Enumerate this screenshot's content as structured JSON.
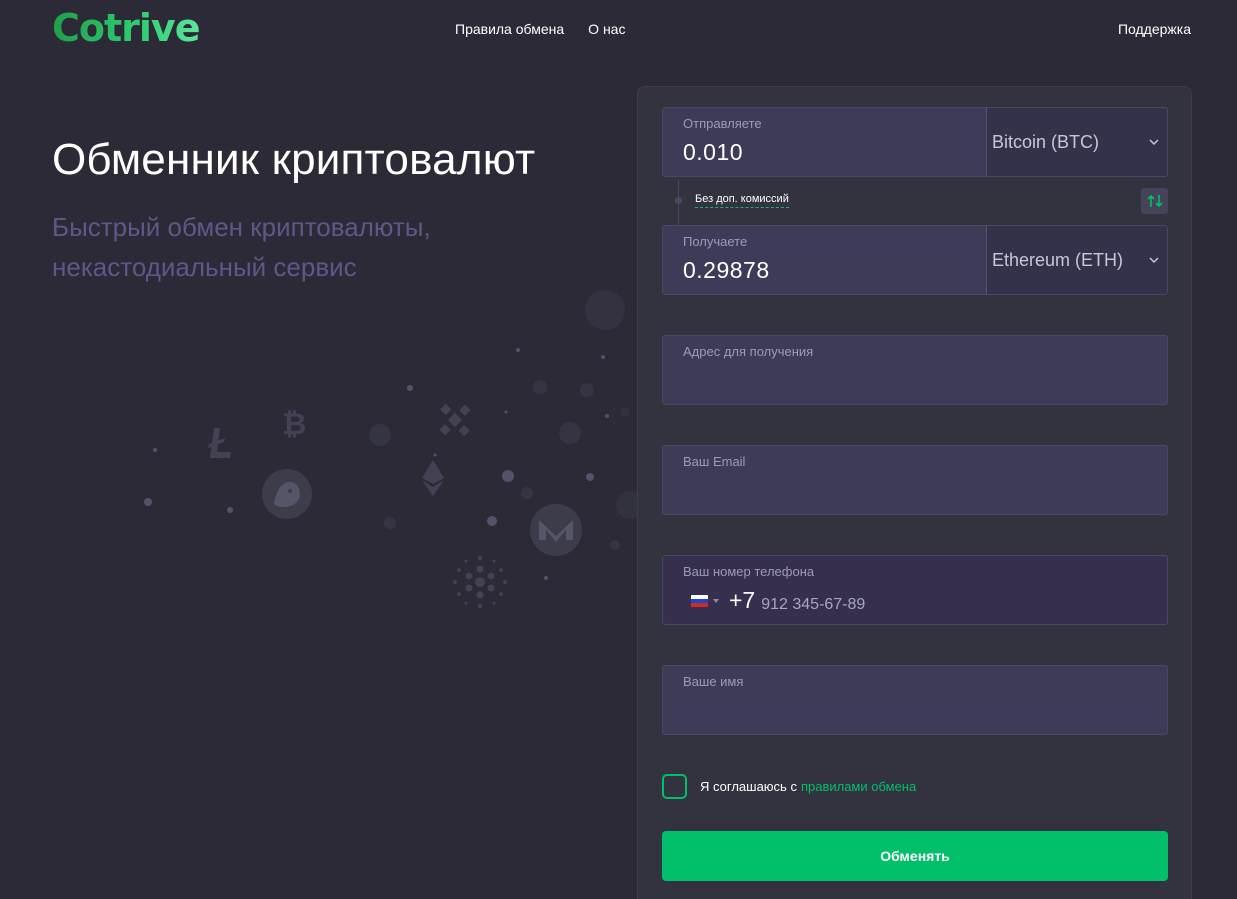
{
  "header": {
    "logo": "Cotrive",
    "nav": [
      "Правила обмена",
      "О нас"
    ],
    "support": "Поддержка"
  },
  "hero": {
    "title": "Обменник криптовалют",
    "subtitle": "Быстрый обмен криптовалюты, некастодиальный сервис"
  },
  "exchange": {
    "send": {
      "label": "Отправляете",
      "amount": "0.010",
      "currency": "Bitcoin (BTC)"
    },
    "no_fee": "Без доп. комиссий",
    "receive": {
      "label": "Получаете",
      "amount": "0.29878",
      "currency": "Ethereum (ETH)"
    }
  },
  "form": {
    "address_label": "Адрес для получения",
    "email_label": "Ваш Email",
    "phone": {
      "label": "Ваш номер телефона",
      "code": "+7",
      "placeholder": "912 345-67-89"
    },
    "name_label": "Ваше имя",
    "agree_text": "Я соглашаюсь с",
    "agree_link": "правилами обмена",
    "submit": "Обменять"
  },
  "colors": {
    "background": "#2b2a36",
    "panel": "#33323f",
    "input": "#3e3b58",
    "accent": "#02bf6a",
    "subtitle": "#5d5887"
  },
  "icons": [
    "chevron-down-icon",
    "swap-arrows-icon",
    "russia-flag-icon",
    "bitcoin-icon",
    "litecoin-icon",
    "binance-icon",
    "ethereum-icon",
    "dogecoin-icon",
    "monero-icon",
    "cardano-icon"
  ]
}
